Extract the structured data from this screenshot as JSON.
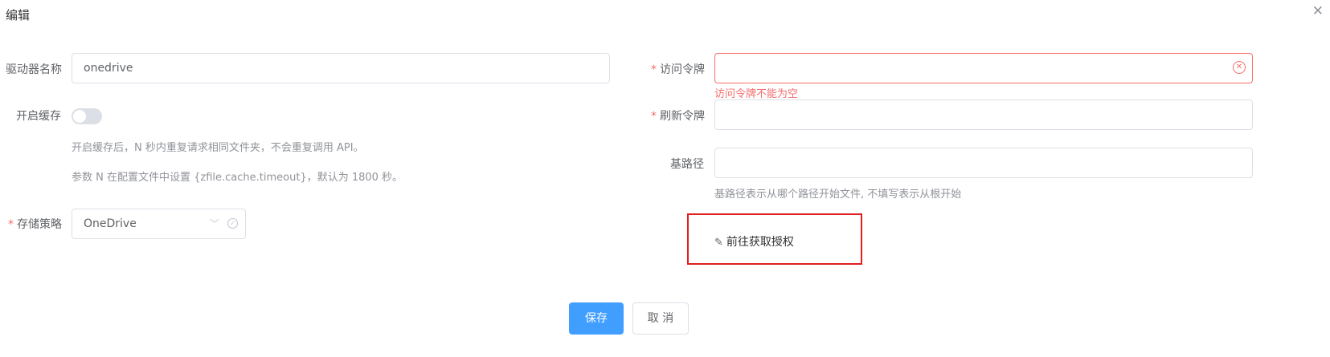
{
  "dialog": {
    "title": "编辑",
    "close_icon": "close-icon"
  },
  "left": {
    "driver_name": {
      "label": "驱动器名称",
      "value": "onedrive"
    },
    "cache": {
      "label": "开启缓存",
      "enabled": false,
      "hint1": "开启缓存后，N 秒内重复请求相同文件夹，不会重复调用 API。",
      "hint2": "参数 N 在配置文件中设置 {zfile.cache.timeout}，默认为 1800 秒。"
    },
    "storage": {
      "label": "存储策略",
      "required_mark": "*",
      "value": "OneDrive",
      "arrow_icon": "chevron-down-icon",
      "check_icon": "circle-check-icon"
    }
  },
  "right": {
    "access_token": {
      "label": "访问令牌",
      "required_mark": "*",
      "value": "",
      "error": "访问令牌不能为空",
      "error_icon": "circle-close-icon"
    },
    "refresh_token": {
      "label": "刷新令牌",
      "required_mark": "*",
      "value": ""
    },
    "base_path": {
      "label": "基路径",
      "value": "",
      "hint": "基路径表示从哪个路径开始文件, 不填写表示从根开始"
    },
    "auth_link": {
      "label": "前往获取授权",
      "icon": "edit-icon"
    }
  },
  "footer": {
    "save_label": "保存",
    "cancel_label": "取 消"
  },
  "colors": {
    "primary": "#409eff",
    "error": "#f56c6c",
    "highlight_box": "#e02020"
  }
}
